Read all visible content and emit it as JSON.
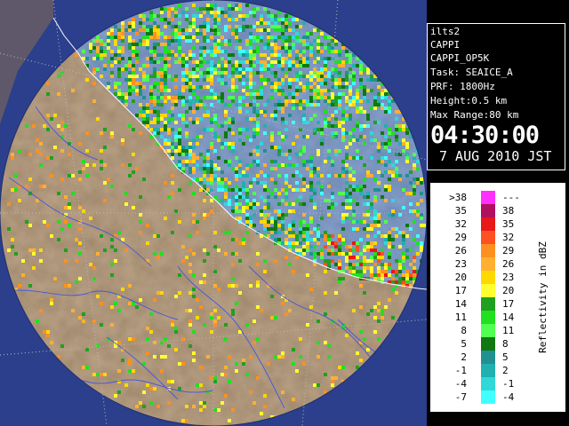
{
  "info": {
    "lines": [
      "ilts2",
      "CAPPI",
      "CAPPI_OP5K",
      "Task: SEAICE_A",
      "PRF: 1800Hz",
      "Height:0.5 km",
      "Max Range:80 km"
    ],
    "time": "04:30:00",
    "date": "7 AUG 2010 JST"
  },
  "legend": {
    "title": "Reflectivity in dBZ",
    "rows": [
      {
        "low": ">38",
        "high": "---",
        "color": "#ff30ff"
      },
      {
        "low": "35",
        "high": "38",
        "color": "#b01060"
      },
      {
        "low": "32",
        "high": "35",
        "color": "#e81818"
      },
      {
        "low": "29",
        "high": "32",
        "color": "#ff5020"
      },
      {
        "low": "26",
        "high": "29",
        "color": "#ff9020"
      },
      {
        "low": "23",
        "high": "26",
        "color": "#ffb030"
      },
      {
        "low": "20",
        "high": "23",
        "color": "#ffd800"
      },
      {
        "low": "17",
        "high": "20",
        "color": "#ffff30"
      },
      {
        "low": "14",
        "high": "17",
        "color": "#20a020"
      },
      {
        "low": "11",
        "high": "14",
        "color": "#20e020"
      },
      {
        "low": "8",
        "high": "11",
        "color": "#50ff50"
      },
      {
        "low": "5",
        "high": "8",
        "color": "#107810"
      },
      {
        "low": "2",
        "high": "5",
        "color": "#209090"
      },
      {
        "low": "-1",
        "high": "2",
        "color": "#20b0b0"
      },
      {
        "low": "-4",
        "high": "-1",
        "color": "#30d8d8"
      },
      {
        "low": "-7",
        "high": "-4",
        "color": "#40ffff"
      }
    ]
  },
  "map": {
    "sea_color": "#1a6ee8",
    "land_color": "#8a6e4e",
    "outside_color": "#2a3a8a",
    "grid_color": "#bbbbbb",
    "river_color": "#4a5ad8"
  }
}
